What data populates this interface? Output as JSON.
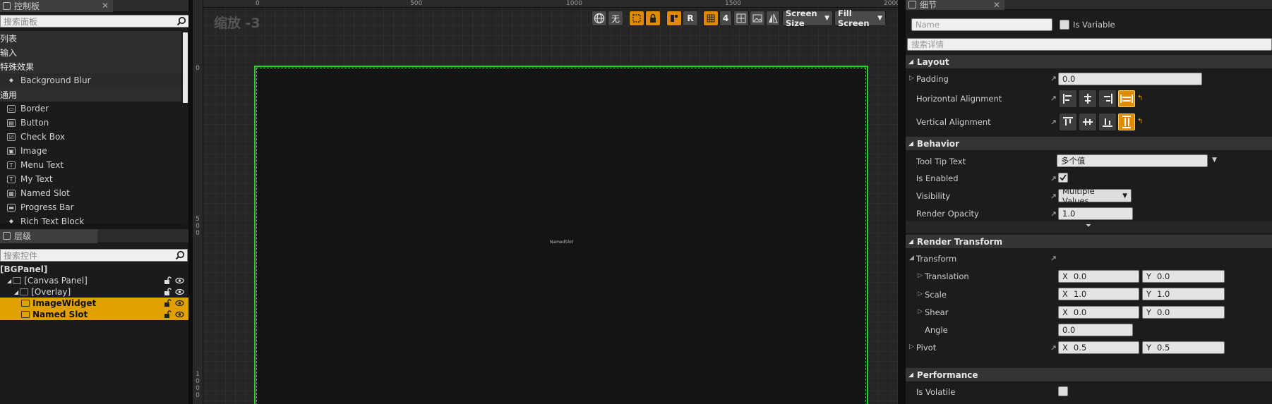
{
  "palette": {
    "tab_label": "控制板",
    "search_placeholder": "搜索面板",
    "rows": [
      {
        "kind": "cat",
        "label": "列表"
      },
      {
        "kind": "cat",
        "label": "输入"
      },
      {
        "kind": "cat",
        "label": "特殊效果"
      },
      {
        "kind": "item",
        "label": "Background Blur",
        "icon": "diamond-icon"
      },
      {
        "kind": "cat",
        "label": "通用"
      },
      {
        "kind": "item",
        "label": "Border",
        "icon": "border-icon"
      },
      {
        "kind": "item",
        "label": "Button",
        "icon": "button-icon"
      },
      {
        "kind": "item",
        "label": "Check Box",
        "icon": "checkbox-icon"
      },
      {
        "kind": "item",
        "label": "Image",
        "icon": "image-icon"
      },
      {
        "kind": "item",
        "label": "Menu Text",
        "icon": "text-icon"
      },
      {
        "kind": "item",
        "label": "My Text",
        "icon": "text-icon"
      },
      {
        "kind": "item",
        "label": "Named Slot",
        "icon": "slot-icon"
      },
      {
        "kind": "item",
        "label": "Progress Bar",
        "icon": "progress-icon"
      },
      {
        "kind": "item",
        "label": "Rich Text Block",
        "icon": "diamond-icon"
      }
    ]
  },
  "hierarchy": {
    "tab_label": "层级",
    "search_placeholder": "搜索控件",
    "rows": [
      {
        "label": "[BGPanel]",
        "indent": 0,
        "selected": false,
        "controls": false,
        "bold": true
      },
      {
        "label": "[Canvas Panel]",
        "indent": 1,
        "selected": false,
        "controls": true,
        "bold": false
      },
      {
        "label": "[Overlay]",
        "indent": 2,
        "selected": false,
        "controls": true,
        "bold": false
      },
      {
        "label": "ImageWidget",
        "indent": 3,
        "selected": true,
        "controls": true,
        "bold": true
      },
      {
        "label": "Named Slot",
        "indent": 3,
        "selected": true,
        "controls": true,
        "bold": true
      }
    ]
  },
  "designer": {
    "zoom_label": "缩放 -3",
    "ruler_top": [
      "0",
      "500",
      "1000",
      "1500",
      "2000"
    ],
    "ruler_left": [
      "0",
      "5\n0\n0",
      "1\n0\n0\n0"
    ],
    "slot_label": "NamedSlot",
    "toolbar": {
      "none_label": "无",
      "r_label": "R",
      "grid_number": "4",
      "screen_size": "Screen Size",
      "fill_screen": "Fill Screen"
    }
  },
  "details": {
    "tab_label": "细节",
    "name_placeholder": "Name",
    "is_variable": "Is Variable",
    "search_placeholder": "搜索详情",
    "layout": {
      "title": "Layout",
      "padding_label": "Padding",
      "padding_value": "0.0",
      "h_align_label": "Horizontal Alignment",
      "v_align_label": "Vertical Alignment"
    },
    "behavior": {
      "title": "Behavior",
      "tooltip_label": "Tool Tip Text",
      "tooltip_value": "多个值",
      "enabled_label": "Is Enabled",
      "visibility_label": "Visibility",
      "visibility_value": "Multiple Values",
      "opacity_label": "Render Opacity",
      "opacity_value": "1.0"
    },
    "render_transform": {
      "title": "Render Transform",
      "transform_label": "Transform",
      "translation_label": "Translation",
      "translation_x": "0.0",
      "translation_y": "0.0",
      "scale_label": "Scale",
      "scale_x": "1.0",
      "scale_y": "1.0",
      "shear_label": "Shear",
      "shear_x": "0.0",
      "shear_y": "0.0",
      "angle_label": "Angle",
      "angle_value": "0.0",
      "pivot_label": "Pivot",
      "pivot_x": "0.5",
      "pivot_y": "0.5",
      "x_axis": "X",
      "y_axis": "Y"
    },
    "performance": {
      "title": "Performance",
      "volatile_label": "Is Volatile"
    }
  },
  "colors": {
    "accent": "#e08a00",
    "selection": "#e0a000",
    "widget_outline": "#1ed81e"
  }
}
